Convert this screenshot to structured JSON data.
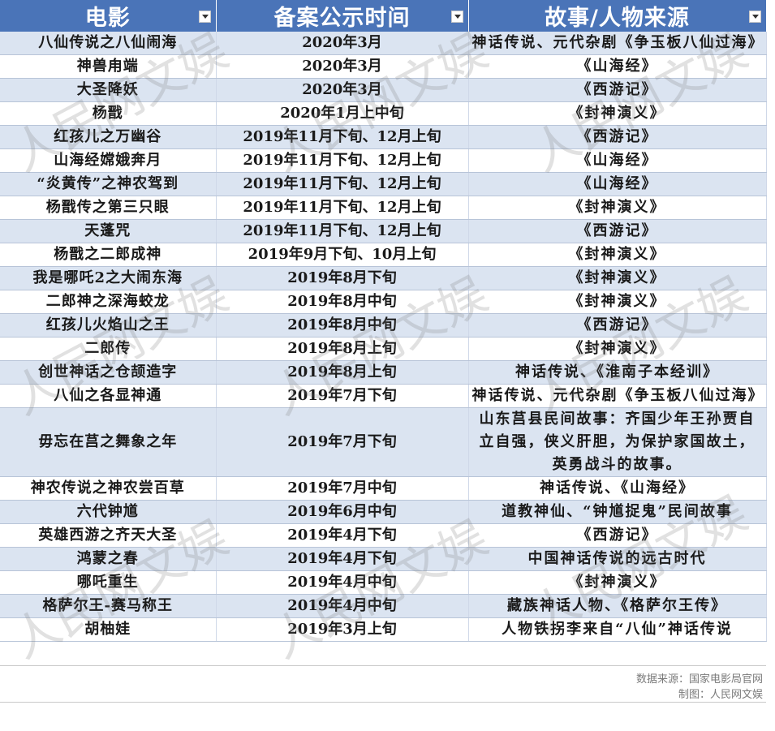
{
  "header": {
    "col1": "电影",
    "col2": "备案公示时间",
    "col3": "故事/人物来源"
  },
  "rows": [
    {
      "film": "八仙传说之八仙闹海",
      "date": "2020年3月",
      "source": "神话传说、元代杂剧《争玉板八仙过海》"
    },
    {
      "film": "神兽甪端",
      "date": "2020年3月",
      "source": "《山海经》"
    },
    {
      "film": "大圣降妖",
      "date": "2020年3月",
      "source": "《西游记》"
    },
    {
      "film": "杨戬",
      "date": "2020年1月上中旬",
      "source": "《封神演义》"
    },
    {
      "film": "红孩儿之万幽谷",
      "date": "2019年11月下旬、12月上旬",
      "source": "《西游记》"
    },
    {
      "film": "山海经嫦娥奔月",
      "date": "2019年11月下旬、12月上旬",
      "source": "《山海经》"
    },
    {
      "film": "“炎黄传”之神农驾到",
      "date": "2019年11月下旬、12月上旬",
      "source": "《山海经》"
    },
    {
      "film": "杨戬传之第三只眼",
      "date": "2019年11月下旬、12月上旬",
      "source": "《封神演义》"
    },
    {
      "film": "天蓬咒",
      "date": "2019年11月下旬、12月上旬",
      "source": "《西游记》"
    },
    {
      "film": "杨戬之二郎成神",
      "date": "2019年9月下旬、10月上旬",
      "source": "《封神演义》"
    },
    {
      "film": "我是哪吒2之大闹东海",
      "date": "2019年8月下旬",
      "source": "《封神演义》"
    },
    {
      "film": "二郎神之深海蛟龙",
      "date": "2019年8月中旬",
      "source": "《封神演义》"
    },
    {
      "film": "红孩儿火焰山之王",
      "date": "2019年8月中旬",
      "source": "《西游记》"
    },
    {
      "film": "二郎传",
      "date": "2019年8月上旬",
      "source": "《封神演义》"
    },
    {
      "film": "创世神话之仓颉造字",
      "date": "2019年8月上旬",
      "source": "神话传说、《淮南子本经训》"
    },
    {
      "film": "八仙之各显神通",
      "date": "2019年7月下旬",
      "source": "神话传说、元代杂剧《争玉板八仙过海》"
    },
    {
      "film": "毋忘在莒之舞象之年",
      "date": "2019年7月下旬",
      "source": "山东莒县民间故事：齐国少年王孙贾自立自强，侠义肝胆，为保护家国故土，英勇战斗的故事。"
    },
    {
      "film": "神农传说之神农尝百草",
      "date": "2019年7月中旬",
      "source": "神话传说、《山海经》"
    },
    {
      "film": "六代钟馗",
      "date": "2019年6月中旬",
      "source": "道教神仙、“钟馗捉鬼”民间故事"
    },
    {
      "film": "英雄西游之齐天大圣",
      "date": "2019年4月下旬",
      "source": "《西游记》"
    },
    {
      "film": "鸿蒙之春",
      "date": "2019年4月下旬",
      "source": "中国神话传说的远古时代"
    },
    {
      "film": "哪吒重生",
      "date": "2019年4月中旬",
      "source": "《封神演义》"
    },
    {
      "film": "格萨尔王-赛马称王",
      "date": "2019年4月中旬",
      "source": "藏族神话人物、《格萨尔王传》"
    },
    {
      "film": "胡柚娃",
      "date": "2019年3月上旬",
      "source": "人物铁拐李来自“八仙”神话传说"
    }
  ],
  "footer": {
    "source": "数据来源：国家电影局官网",
    "credit": "制图：人民网文娱"
  },
  "watermark": "人民网文娱",
  "colors": {
    "header_bg": "#4a74b8",
    "band": "#dbe4f1"
  }
}
